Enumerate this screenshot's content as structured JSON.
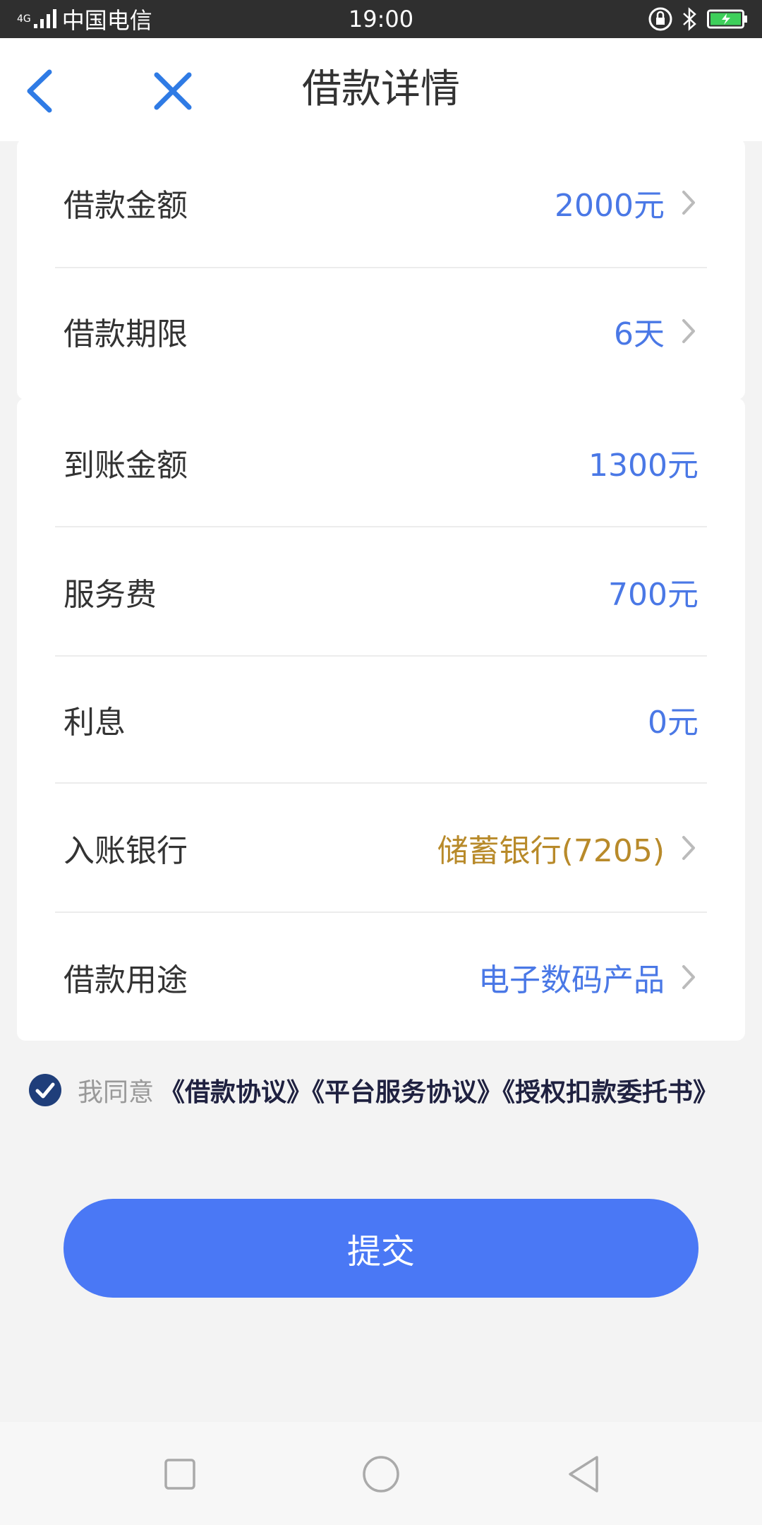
{
  "status_bar": {
    "network": "4G",
    "carrier": "中国电信",
    "time": "19:00"
  },
  "header": {
    "title": "借款详情",
    "back_icon": "chevron-left-icon",
    "close_icon": "close-icon"
  },
  "loan_card": {
    "rows": [
      {
        "label": "借款金额",
        "value": "2000元"
      },
      {
        "label": "借款期限",
        "value": "6天"
      }
    ]
  },
  "detail_card": {
    "rows": [
      {
        "label": "到账金额",
        "value": "1300元"
      },
      {
        "label": "服务费",
        "value": "700元"
      },
      {
        "label": "利息",
        "value": "0元"
      },
      {
        "label": "入账银行",
        "value": "储蓄银行(7205)"
      },
      {
        "label": "借款用途",
        "value": "电子数码产品"
      }
    ]
  },
  "agreement": {
    "checked": true,
    "prefix": "我同意",
    "links": "《借款协议》《平台服务协议》《授权扣款委托书》"
  },
  "submit": {
    "label": "提交"
  },
  "colors": {
    "accent": "#4a78f5",
    "value_blue": "#4a78e6",
    "bank_gold": "#b88a2a"
  }
}
